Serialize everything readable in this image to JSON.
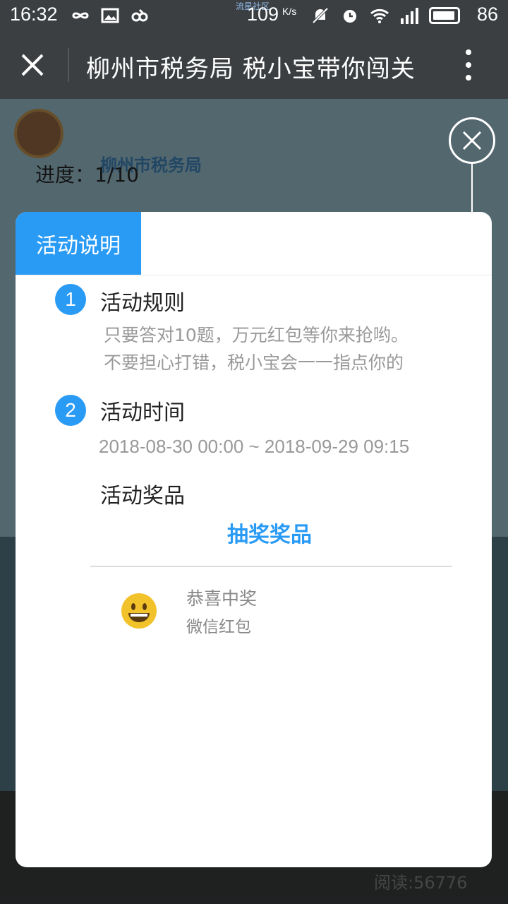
{
  "status_bar": {
    "time": "16:32",
    "watermark": "流星社区",
    "network_speed": "109",
    "network_speed_unit": "K/s",
    "battery": "86"
  },
  "title_bar": {
    "title": "柳州市税务局 税小宝带你闯关"
  },
  "background": {
    "org_name": "柳州市税务局",
    "progress": "进度：1/10",
    "read_count": "阅读:56776"
  },
  "modal": {
    "tab_label": "活动说明",
    "rules": {
      "number": "1",
      "title": "活动规则",
      "lines": [
        "只要答对10题，万元红包等你来抢哟。",
        "不要担心打错，税小宝会一一指点你的"
      ]
    },
    "time": {
      "number": "2",
      "title": "活动时间",
      "range": "2018-08-30 00:00 ~ 2018-09-29 09:15"
    },
    "prizes": {
      "title": "活动奖品",
      "link": "抽奖奖品",
      "item_title": "恭喜中奖",
      "item_sub": "微信红包"
    }
  },
  "colors": {
    "accent": "#2a9bf5",
    "titlebar": "#3b3f42"
  }
}
